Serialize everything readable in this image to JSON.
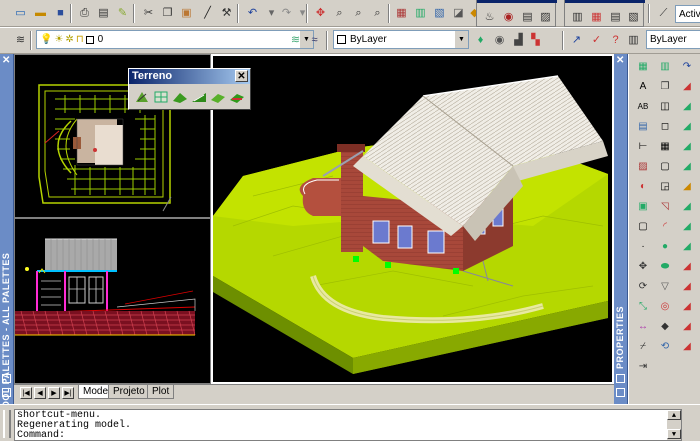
{
  "layer_combo": {
    "value": "0"
  },
  "color_combo": {
    "value": "ByLayer"
  },
  "linetype_combo": {
    "value": "ByLayer"
  },
  "lineweight_combo": {
    "value": "Activ"
  },
  "left_strip": {
    "label": "TOOL PALETTES - ALL PALETTES"
  },
  "right_strip": {
    "label": "PROPERTIES"
  },
  "floating_toolbar": {
    "title": "Terreno",
    "close_label": "✕"
  },
  "tabs": {
    "items": [
      "Model",
      "Projeto",
      "Plot"
    ],
    "nav": [
      "◀",
      "▶",
      "▶|",
      "|◀"
    ]
  },
  "command_line": {
    "lines": [
      "shortcut-menu.",
      "Regenerating model.",
      "Command:"
    ]
  }
}
